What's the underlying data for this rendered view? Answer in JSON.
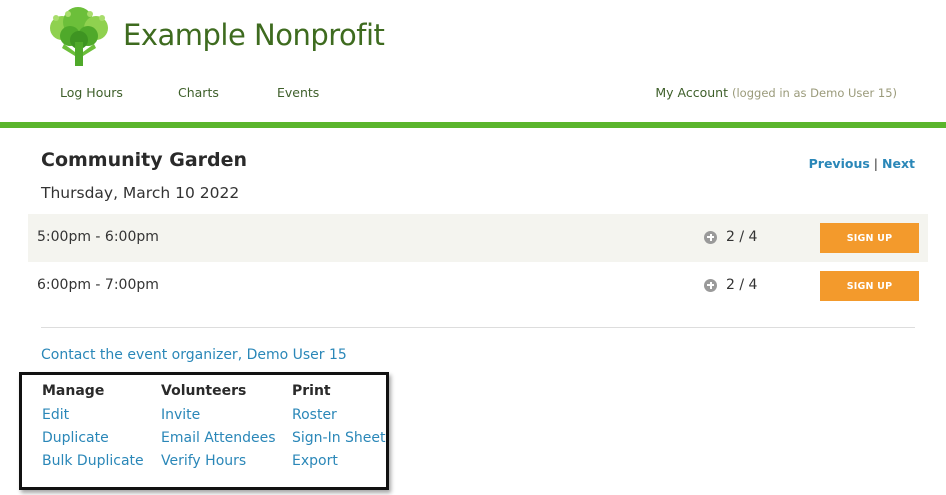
{
  "header": {
    "org_name": "Example Nonprofit",
    "logo_icon": "tree-of-people-icon",
    "nav": [
      {
        "label": "Log Hours"
      },
      {
        "label": "Charts"
      },
      {
        "label": "Events"
      }
    ],
    "account": {
      "label": "My Account",
      "status": "(logged in as Demo User 15)"
    },
    "accent_color": "#5ab52c"
  },
  "event": {
    "title": "Community Garden",
    "date": "Thursday, March 10 2022",
    "pager": {
      "previous": "Previous",
      "separator": "|",
      "next": "Next"
    }
  },
  "shifts": [
    {
      "time": "5:00pm - 6:00pm",
      "count": "2 / 4",
      "button": "SIGN UP"
    },
    {
      "time": "6:00pm - 7:00pm",
      "count": "2 / 4",
      "button": "SIGN UP"
    }
  ],
  "contact": "Contact the event organizer, Demo User 15",
  "actions": {
    "manage": {
      "heading": "Manage",
      "links": [
        "Edit",
        "Duplicate",
        "Bulk Duplicate"
      ]
    },
    "volunteers": {
      "heading": "Volunteers",
      "links": [
        "Invite",
        "Email Attendees",
        "Verify Hours"
      ]
    },
    "print": {
      "heading": "Print",
      "links": [
        "Roster",
        "Sign-In Sheet",
        "Export"
      ]
    }
  },
  "colors": {
    "link": "#2a87b8",
    "button": "#f39a2c",
    "brand_text": "#3e6b1f"
  }
}
